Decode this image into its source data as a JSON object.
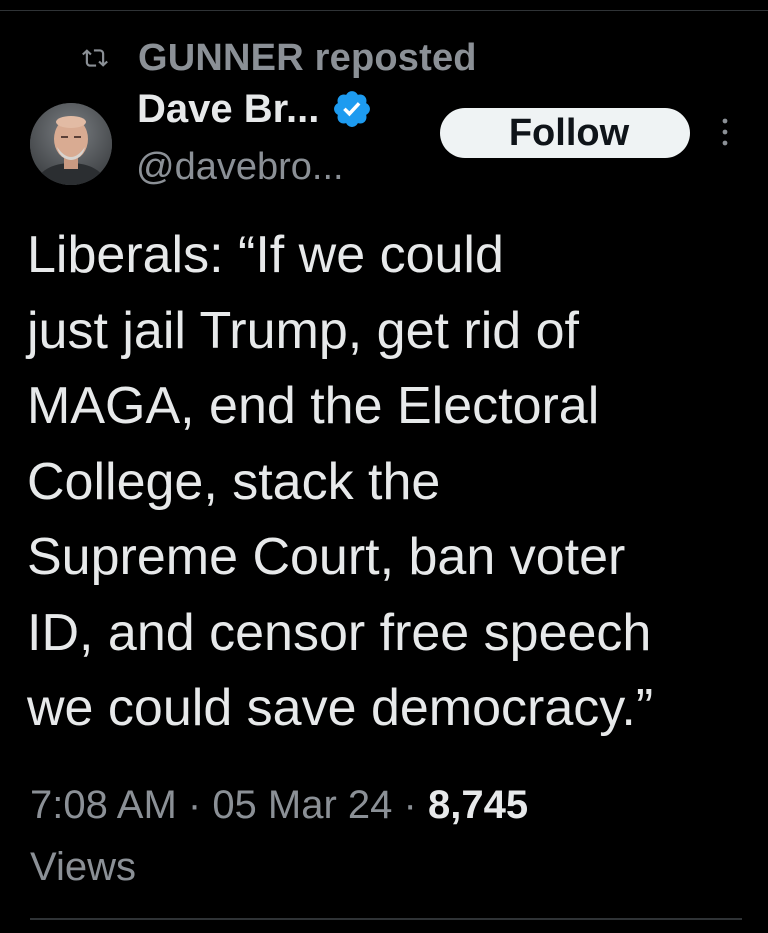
{
  "repost": {
    "icon": "repost-icon",
    "label": "GUNNER reposted"
  },
  "author": {
    "avatar": "avatar",
    "display_name": "Dave Br...",
    "verified_icon": "verified-badge-icon",
    "verified_color": "#1d9bf0",
    "handle": "@davebro..."
  },
  "follow_button": {
    "label": "Follow"
  },
  "more_icon": "more-vertical-icon",
  "tweet": {
    "lines": [
      "Liberals: “If we could",
      "just jail Trump, get rid of",
      "MAGA, end the Electoral",
      "College, stack the",
      "Supreme Court, ban voter",
      "ID, and censor free speech",
      "we could save democracy.”"
    ]
  },
  "meta": {
    "time": "7:08 AM",
    "separator": " · ",
    "date": "05 Mar 24",
    "views_count": "8,745",
    "views_label": "Views"
  },
  "colors": {
    "background": "#000000",
    "text_primary": "#e7e9ea",
    "text_secondary": "#8b9096",
    "follow_bg": "#eff3f4",
    "divider": "#2f3336"
  }
}
